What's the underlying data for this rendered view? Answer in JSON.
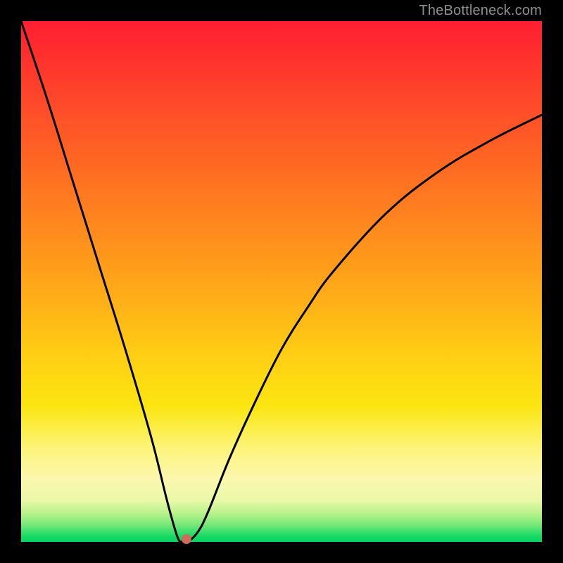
{
  "watermark": "TheBottleneck.com",
  "colors": {
    "background": "#000000",
    "curve": "#000000",
    "marker": "#d06a5a",
    "watermark_text": "#8f8f8f"
  },
  "chart_data": {
    "type": "line",
    "title": "",
    "xlabel": "",
    "ylabel": "",
    "xlim": [
      0,
      100
    ],
    "ylim": [
      0,
      100
    ],
    "grid": false,
    "legend": false,
    "annotations": [],
    "background_gradient_stops": [
      {
        "pos": 0,
        "color": "#ff1e32"
      },
      {
        "pos": 16,
        "color": "#ff4a2a"
      },
      {
        "pos": 40,
        "color": "#ff8a1e"
      },
      {
        "pos": 64,
        "color": "#ffce14"
      },
      {
        "pos": 82,
        "color": "#fdf47a"
      },
      {
        "pos": 94,
        "color": "#b9f28c"
      },
      {
        "pos": 100,
        "color": "#05d45f"
      }
    ],
    "series": [
      {
        "name": "bottleneck-curve",
        "x": [
          0,
          5,
          10,
          15,
          20,
          25,
          28,
          30,
          31,
          32,
          34,
          36,
          40,
          45,
          50,
          55,
          60,
          70,
          80,
          90,
          100
        ],
        "y": [
          100,
          85,
          69,
          53,
          37,
          20,
          8,
          1,
          0,
          0,
          2,
          6,
          16,
          27,
          37,
          45,
          52,
          63,
          71,
          77,
          82
        ]
      }
    ],
    "marker": {
      "x": 31.7,
      "y": 0.5
    }
  }
}
